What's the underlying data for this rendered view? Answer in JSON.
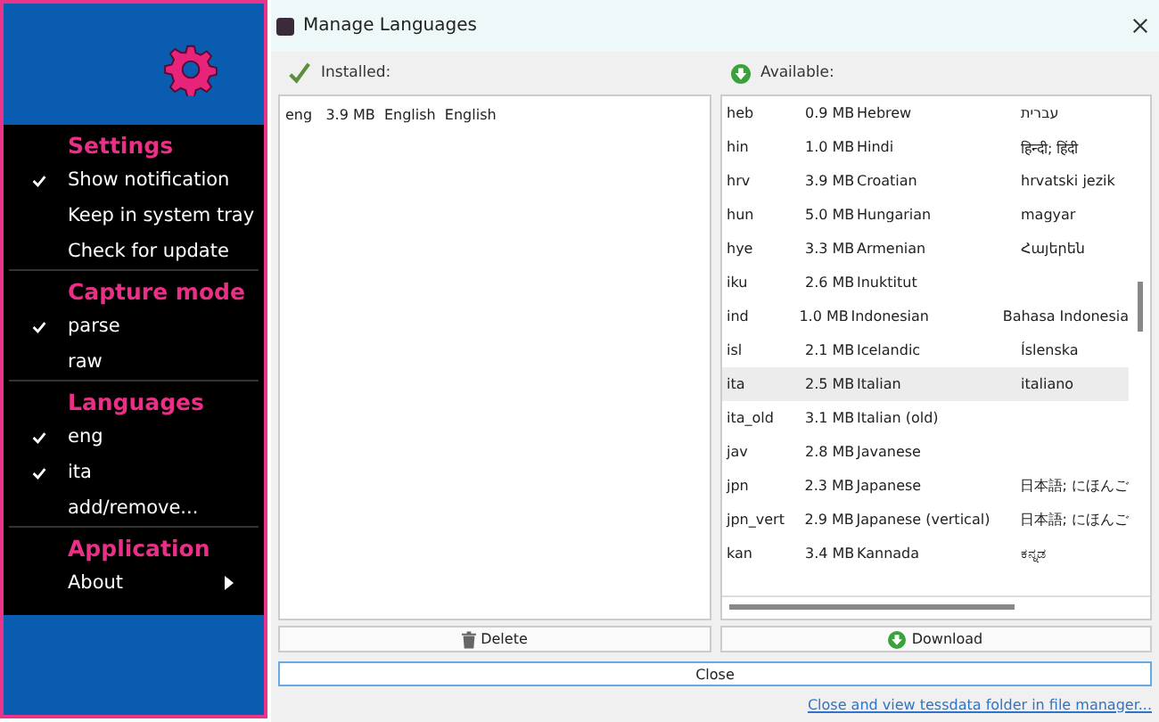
{
  "menu": {
    "sections": [
      {
        "title": "Settings",
        "items": [
          {
            "label": "Show notification",
            "checked": true,
            "submenu": false
          },
          {
            "label": "Keep in system tray",
            "checked": false,
            "submenu": false
          },
          {
            "label": "Check for update",
            "checked": false,
            "submenu": false
          }
        ]
      },
      {
        "title": "Capture mode",
        "items": [
          {
            "label": "parse",
            "checked": true,
            "submenu": false
          },
          {
            "label": "raw",
            "checked": false,
            "submenu": false
          }
        ]
      },
      {
        "title": "Languages",
        "items": [
          {
            "label": "eng",
            "checked": true,
            "submenu": false
          },
          {
            "label": "ita",
            "checked": true,
            "submenu": false
          },
          {
            "label": "add/remove...",
            "checked": false,
            "submenu": false
          }
        ]
      },
      {
        "title": "Application",
        "items": [
          {
            "label": "About",
            "checked": false,
            "submenu": true
          }
        ]
      }
    ]
  },
  "dialog": {
    "title": "Manage Languages",
    "installed": {
      "heading": "Installed:",
      "rows": [
        {
          "code": "eng",
          "size": "3.9 MB",
          "name": "English",
          "native": "English",
          "selected": false
        }
      ]
    },
    "available": {
      "heading": "Available:",
      "rows": [
        {
          "code": "heb",
          "size": "0.9 MB",
          "name": "Hebrew",
          "native": "עברית",
          "selected": false
        },
        {
          "code": "hin",
          "size": "1.0 MB",
          "name": "Hindi",
          "native": "हिन्दी; हिंदी",
          "selected": false
        },
        {
          "code": "hrv",
          "size": "3.9 MB",
          "name": "Croatian",
          "native": "hrvatski jezik",
          "selected": false
        },
        {
          "code": "hun",
          "size": "5.0 MB",
          "name": "Hungarian",
          "native": "magyar",
          "selected": false
        },
        {
          "code": "hye",
          "size": "3.3 MB",
          "name": "Armenian",
          "native": "Հայերեն",
          "selected": false
        },
        {
          "code": "iku",
          "size": "2.6 MB",
          "name": "Inuktitut",
          "native": "",
          "selected": false
        },
        {
          "code": "ind",
          "size": "1.0 MB",
          "name": "Indonesian",
          "native": "Bahasa Indonesia",
          "selected": false
        },
        {
          "code": "isl",
          "size": "2.1 MB",
          "name": "Icelandic",
          "native": "Íslenska",
          "selected": false
        },
        {
          "code": "ita",
          "size": "2.5 MB",
          "name": "Italian",
          "native": "italiano",
          "selected": true
        },
        {
          "code": "ita_old",
          "size": "3.1 MB",
          "name": "Italian (old)",
          "native": "",
          "selected": false
        },
        {
          "code": "jav",
          "size": "2.8 MB",
          "name": "Javanese",
          "native": "",
          "selected": false
        },
        {
          "code": "jpn",
          "size": "2.3 MB",
          "name": "Japanese",
          "native": "日本語; にほんご",
          "selected": false
        },
        {
          "code": "jpn_vert",
          "size": "2.9 MB",
          "name": "Japanese (vertical)",
          "native": "日本語; にほんご",
          "selected": false
        },
        {
          "code": "kan",
          "size": "3.4 MB",
          "name": "Kannada",
          "native": "ಕನ್ನಡ",
          "selected": false
        }
      ]
    },
    "delete_button": "Delete",
    "download_button": "Download",
    "close_button": "Close",
    "link": "Close and view tessdata folder in file manager..."
  }
}
